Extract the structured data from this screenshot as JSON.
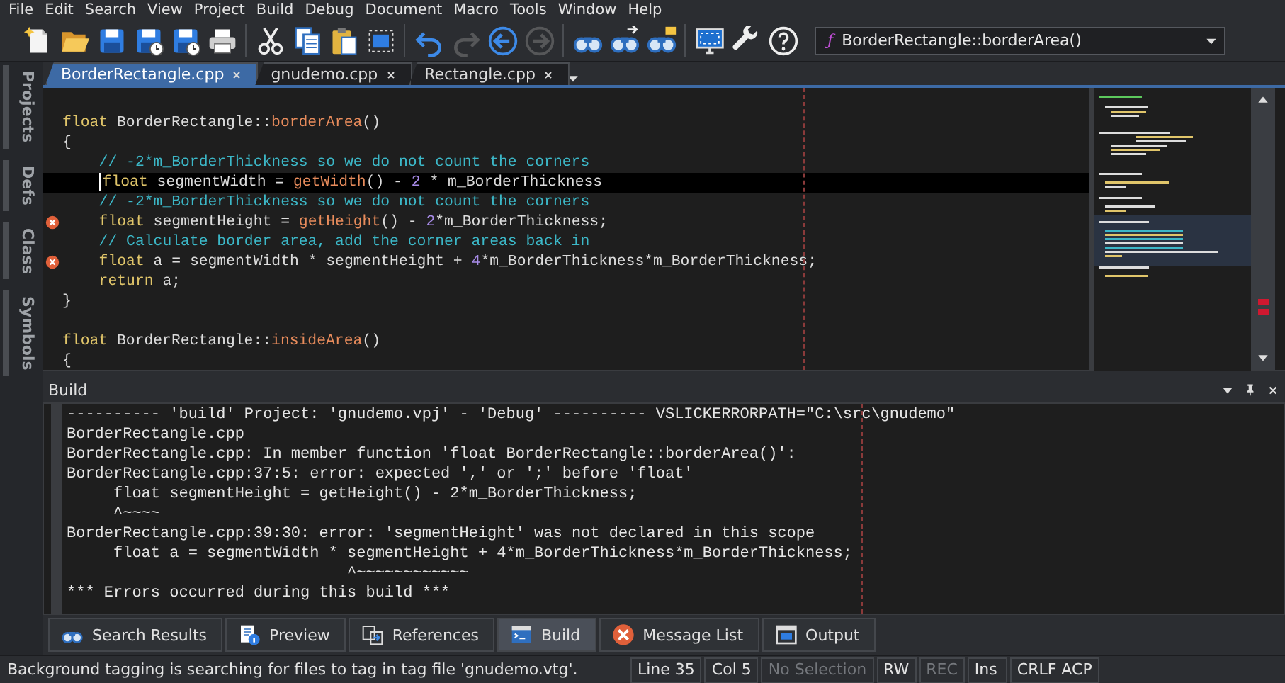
{
  "menu": [
    "File",
    "Edit",
    "Search",
    "View",
    "Project",
    "Build",
    "Debug",
    "Document",
    "Macro",
    "Tools",
    "Window",
    "Help"
  ],
  "toolbar": [
    [
      {
        "disabled": false
      },
      {
        "disabled": false
      },
      {
        "disabled": false
      },
      {
        "disabled": false
      },
      {
        "disabled": false
      },
      {
        "disabled": false
      }
    ],
    [
      {
        "disabled": false
      },
      {
        "disabled": false
      },
      {
        "disabled": false
      },
      {
        "disabled": false
      }
    ],
    [
      {
        "disabled": false
      },
      {
        "disabled": true
      },
      {
        "disabled": false
      },
      {
        "disabled": true
      }
    ],
    [
      {
        "disabled": false
      },
      {
        "disabled": false
      },
      {
        "disabled": false
      }
    ],
    [
      {
        "disabled": false
      },
      {
        "disabled": false
      },
      {
        "disabled": false
      }
    ]
  ],
  "function_selector": {
    "symbol": "ƒ",
    "value": "BorderRectangle::borderArea()"
  },
  "sidebar_tabs": [
    {
      "label": "Projects",
      "selected": false
    },
    {
      "label": "Defs",
      "selected": false
    },
    {
      "label": "Class",
      "selected": false
    },
    {
      "label": "Symbols",
      "selected": false
    }
  ],
  "editor_tabs": [
    {
      "label": "BorderRectangle.cpp",
      "selected": true
    },
    {
      "label": "gnudemo.cpp",
      "selected": false
    },
    {
      "label": "Rectangle.cpp",
      "selected": false
    }
  ],
  "editor": {
    "lines": [
      {
        "current": false,
        "error": false
      },
      {
        "indented": false,
        "current": false,
        "error": false,
        "tokens": [
          {
            "kind": "kw",
            "text": "float"
          },
          {
            "kind": "id",
            "text": " BorderRectangle::"
          },
          {
            "kind": "fn",
            "text": "borderArea"
          },
          {
            "kind": "id",
            "text": "()"
          }
        ]
      },
      {
        "indented": false,
        "current": false,
        "error": false,
        "tokens": [
          {
            "kind": "id",
            "text": "{"
          }
        ]
      },
      {
        "indented": true,
        "current": false,
        "error": false,
        "tokens": [
          {
            "kind": "cm",
            "text": "// -2*m_BorderThickness so we do not count the corners"
          }
        ]
      },
      {
        "indented": true,
        "current": true,
        "error": false,
        "tokens": [
          {
            "kind": "kw",
            "text": "float"
          },
          {
            "kind": "id",
            "text": " segmentWidth = "
          },
          {
            "kind": "fn",
            "text": "getWidth"
          },
          {
            "kind": "id",
            "text": "() - "
          },
          {
            "kind": "num",
            "text": "2"
          },
          {
            "kind": "id",
            "text": " * m_BorderThickness"
          }
        ]
      },
      {
        "indented": true,
        "current": false,
        "error": false,
        "tokens": [
          {
            "kind": "cm",
            "text": "// -2*m_BorderThickness so we do not count the corners"
          }
        ]
      },
      {
        "indented": true,
        "current": false,
        "error": true,
        "tokens": [
          {
            "kind": "kw",
            "text": "float"
          },
          {
            "kind": "id",
            "text": " segmentHeight = "
          },
          {
            "kind": "fn",
            "text": "getHeight"
          },
          {
            "kind": "id",
            "text": "() - "
          },
          {
            "kind": "num",
            "text": "2"
          },
          {
            "kind": "id",
            "text": "*m_BorderThickness;"
          }
        ]
      },
      {
        "indented": true,
        "current": false,
        "error": false,
        "tokens": [
          {
            "kind": "cm",
            "text": "// Calculate border area, add the corner areas back in"
          }
        ]
      },
      {
        "indented": true,
        "current": false,
        "error": true,
        "tokens": [
          {
            "kind": "kw",
            "text": "float"
          },
          {
            "kind": "id",
            "text": " a = segmentWidth * segmentHeight + "
          },
          {
            "kind": "num",
            "text": "4"
          },
          {
            "kind": "id",
            "text": "*m_BorderThickness*m_BorderThickness;"
          }
        ]
      },
      {
        "indented": true,
        "current": false,
        "error": false,
        "tokens": [
          {
            "kind": "kw",
            "text": "return"
          },
          {
            "kind": "id",
            "text": " a;"
          }
        ]
      },
      {
        "indented": false,
        "current": false,
        "error": false,
        "tokens": [
          {
            "kind": "id",
            "text": "}"
          }
        ]
      },
      {
        "current": false,
        "error": false
      },
      {
        "indented": false,
        "current": false,
        "error": false,
        "tokens": [
          {
            "kind": "kw",
            "text": "float"
          },
          {
            "kind": "id",
            "text": " BorderRectangle::"
          },
          {
            "kind": "fn",
            "text": "insideArea"
          },
          {
            "kind": "id",
            "text": "()"
          }
        ]
      },
      {
        "indented": false,
        "current": false,
        "error": false,
        "tokens": [
          {
            "kind": "id",
            "text": "{"
          }
        ]
      }
    ]
  },
  "build_panel": {
    "title": "Build",
    "lines": [
      "---------- 'build' Project: 'gnudemo.vpj' - 'Debug' ---------- VSLICKERRORPATH=\"C:\\src\\gnudemo\"",
      "BorderRectangle.cpp",
      "BorderRectangle.cpp: In member function 'float BorderRectangle::borderArea()':",
      "BorderRectangle.cpp:37:5: error: expected ',' or ';' before 'float'",
      "     float segmentHeight = getHeight() - 2*m_BorderThickness;",
      "     ^~~~~",
      "BorderRectangle.cpp:39:30: error: 'segmentHeight' was not declared in this scope",
      "     float a = segmentWidth * segmentHeight + 4*m_BorderThickness*m_BorderThickness;",
      "                              ^~~~~~~~~~~~~",
      "*** Errors occurred during this build ***"
    ]
  },
  "bottom_tabs": [
    {
      "label": "Search Results",
      "selected": false
    },
    {
      "label": "Preview",
      "selected": false
    },
    {
      "label": "References",
      "selected": false
    },
    {
      "label": "Build",
      "selected": true
    },
    {
      "label": "Message List",
      "selected": false
    },
    {
      "label": "Output",
      "selected": false
    }
  ],
  "status_bar": {
    "message": "Background tagging is searching for files to tag in tag file 'gnudemo.vtg'.",
    "fields": [
      {
        "text": "Line 35",
        "disabled": false
      },
      {
        "text": "Col 5",
        "disabled": false
      },
      {
        "text": "No Selection",
        "disabled": true
      },
      {
        "text": "RW",
        "disabled": false
      },
      {
        "text": "REC",
        "disabled": true
      },
      {
        "text": "Ins",
        "disabled": false
      },
      {
        "text": "CRLF ACP",
        "disabled": false
      }
    ]
  }
}
